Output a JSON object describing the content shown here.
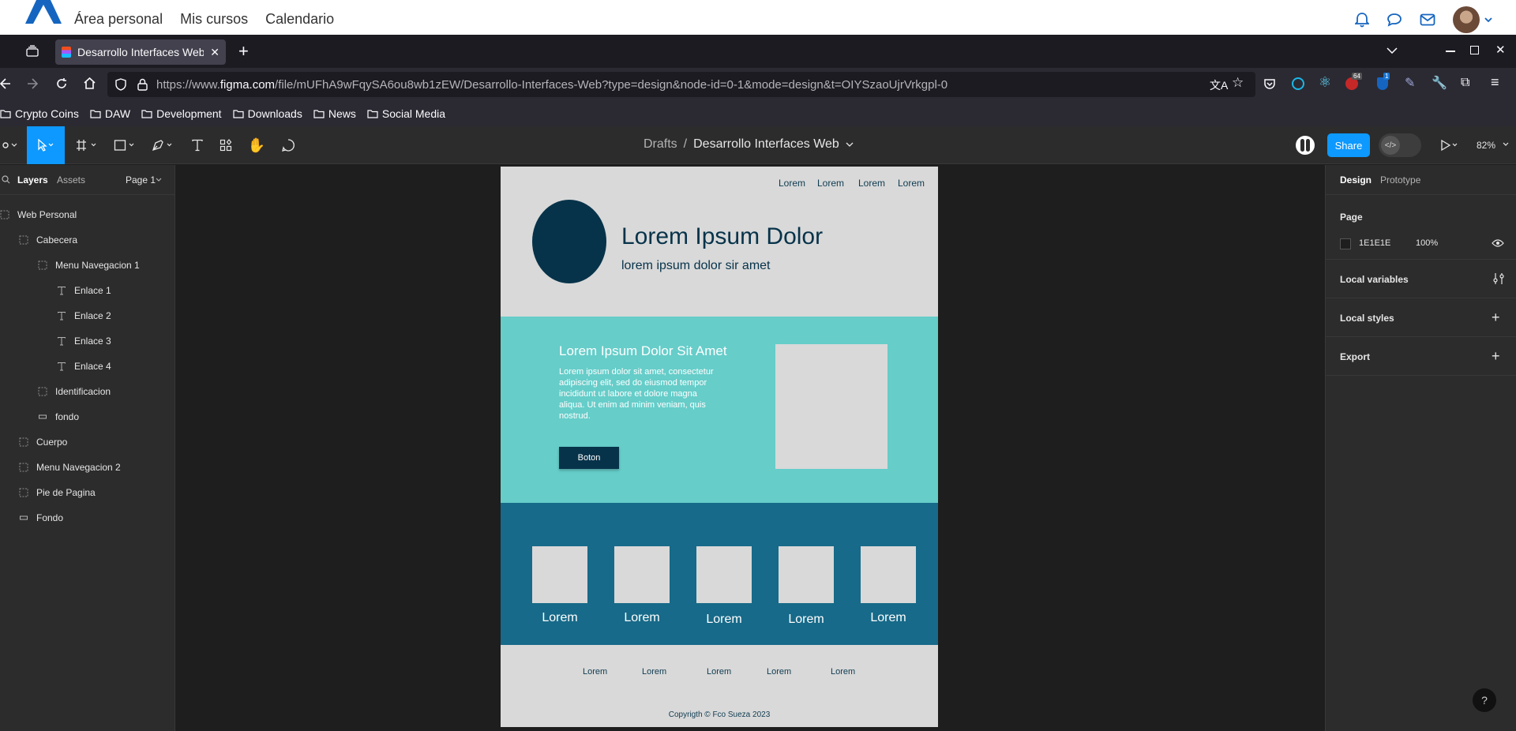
{
  "site": {
    "nav": [
      "Área personal",
      "Mis cursos",
      "Calendario"
    ],
    "icons": [
      "bell-icon",
      "chat-icon",
      "mail-icon",
      "avatar"
    ]
  },
  "browser": {
    "tab_title": "Desarrollo Interfaces Web",
    "new_tab": "+",
    "url_prefix": "https://www.",
    "url_domain": "figma.com",
    "url_rest": "/file/mUFhA9wFqySA6ou8wb1zEW/Desarrollo-Interfaces-Web?type=design&node-id=0-1&mode=design&t=OIYSzaoUjrVrkgpl-0",
    "badges": {
      "ext1": "64",
      "ext2": "1"
    },
    "bookmarks": [
      "Crypto Coins",
      "DAW",
      "Development",
      "Downloads",
      "News",
      "Social Media"
    ]
  },
  "figma": {
    "breadcrumb_root": "Drafts",
    "breadcrumb_sep": "/",
    "file_name": "Desarrollo Interfaces Web",
    "share_label": "Share",
    "zoom": "82%",
    "left_tabs": {
      "layers": "Layers",
      "assets": "Assets",
      "page": "Page 1"
    },
    "layers": [
      {
        "name": "Web Personal",
        "icon": "frame-icon",
        "depth": 0
      },
      {
        "name": "Cabecera",
        "icon": "frame-icon",
        "depth": 1
      },
      {
        "name": "Menu Navegacion 1",
        "icon": "frame-icon",
        "depth": 2
      },
      {
        "name": "Enlace 1",
        "icon": "text-icon",
        "depth": 3
      },
      {
        "name": "Enlace 2",
        "icon": "text-icon",
        "depth": 3
      },
      {
        "name": "Enlace 3",
        "icon": "text-icon",
        "depth": 3
      },
      {
        "name": "Enlace 4",
        "icon": "text-icon",
        "depth": 3
      },
      {
        "name": "Identificacion",
        "icon": "frame-icon",
        "depth": 2
      },
      {
        "name": "fondo",
        "icon": "rect-icon",
        "depth": 2
      },
      {
        "name": "Cuerpo",
        "icon": "frame-icon",
        "depth": 1
      },
      {
        "name": "Menu Navegacion 2",
        "icon": "frame-icon",
        "depth": 1
      },
      {
        "name": "Pie de Pagina",
        "icon": "frame-icon",
        "depth": 1
      },
      {
        "name": "Fondo",
        "icon": "rect-icon",
        "depth": 1
      }
    ],
    "right_tabs": {
      "design": "Design",
      "prototype": "Prototype"
    },
    "page_section": {
      "title": "Page",
      "color": "1E1E1E",
      "opacity": "100%"
    },
    "sections": [
      "Local variables",
      "Local styles",
      "Export"
    ],
    "help": "?"
  },
  "design": {
    "nav_links": [
      "Lorem",
      "Lorem",
      "Lorem",
      "Lorem"
    ],
    "title": "Lorem Ipsum Dolor",
    "subtitle": "lorem ipsum dolor sir amet",
    "hero_title": "Lorem Ipsum Dolor Sit Amet",
    "hero_text": "Lorem ipsum dolor sit amet, consectetur adipiscing elit, sed do eiusmod tempor incididunt ut labore et dolore magna aliqua. Ut enim ad minim veniam, quis nostrud.",
    "button": "Boton",
    "cards": [
      "Lorem",
      "Lorem",
      "Lorem",
      "Lorem",
      "Lorem"
    ],
    "footer_links": [
      "Lorem",
      "Lorem",
      "Lorem",
      "Lorem",
      "Lorem"
    ],
    "copyright": "Copyrigth © Fco Sueza 2023",
    "colors": {
      "header_bg": "#d9d9d9",
      "accent_dark": "#07334a",
      "hero_bg": "#66cdc9",
      "cards_bg": "#176a89"
    }
  }
}
